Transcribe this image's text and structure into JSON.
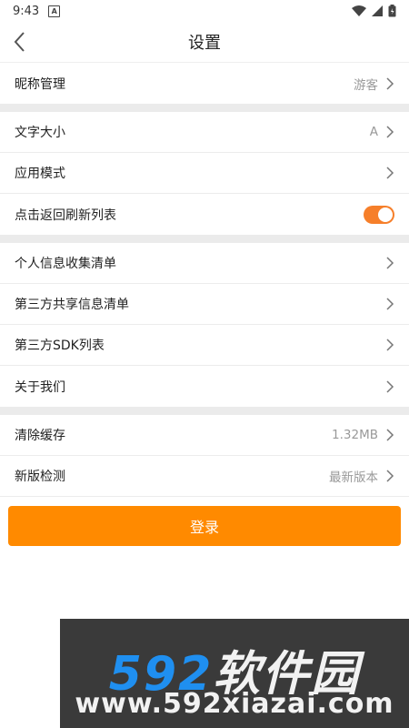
{
  "status": {
    "time": "9:43",
    "badge": "A"
  },
  "header": {
    "title": "设置"
  },
  "section1": [
    {
      "label": "昵称管理",
      "value": "游客"
    }
  ],
  "section2": [
    {
      "label": "文字大小",
      "value": "A"
    },
    {
      "label": "应用模式",
      "value": ""
    },
    {
      "label": "点击返回刷新列表",
      "toggle_on": true
    }
  ],
  "section3": [
    {
      "label": "个人信息收集清单"
    },
    {
      "label": "第三方共享信息清单"
    },
    {
      "label": "第三方SDK列表"
    },
    {
      "label": "关于我们"
    }
  ],
  "section4": [
    {
      "label": "清除缓存",
      "value": "1.32MB"
    },
    {
      "label": "新版检测",
      "value": "最新版本"
    }
  ],
  "login": {
    "label": "登录"
  },
  "watermark": {
    "brand_num": "592",
    "brand_cn": "软件园",
    "url": "www.592xiazai.com"
  },
  "colors": {
    "accent": "#ff8a00",
    "toggle": "#f67f2a",
    "watermark_blue": "#1f8ff0"
  }
}
